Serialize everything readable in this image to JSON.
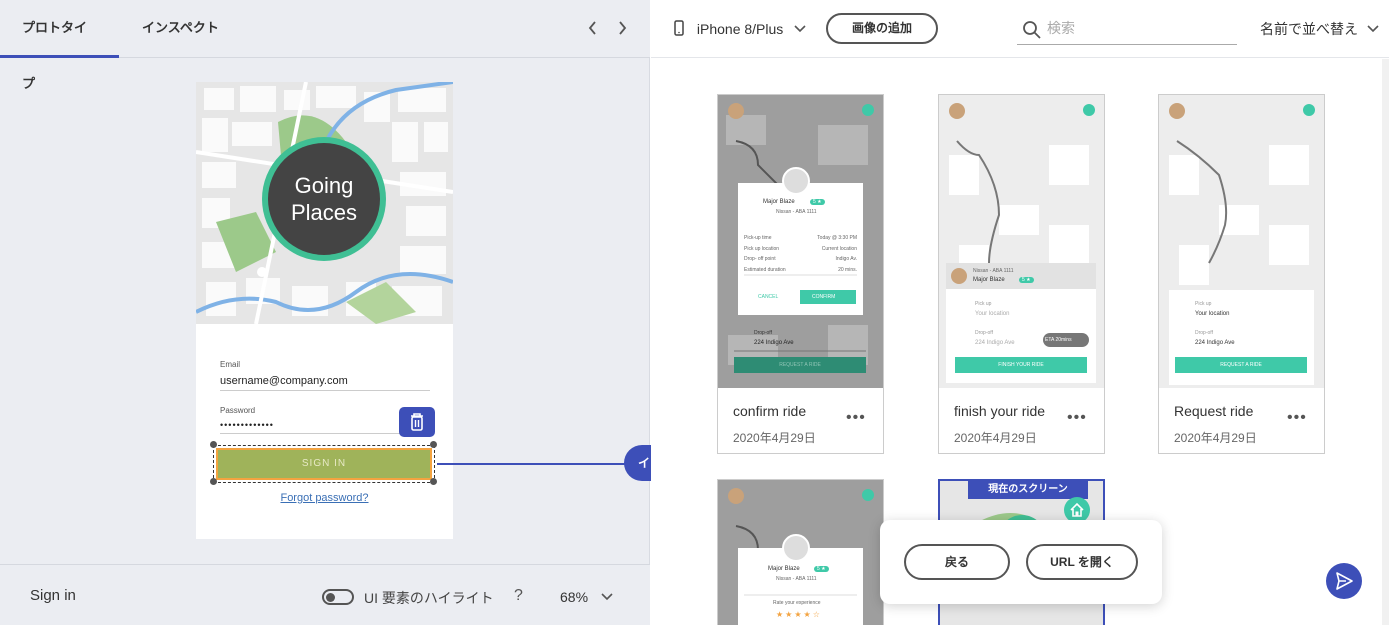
{
  "left_panel": {
    "tabs": [
      {
        "label": "プロトタイプ"
      },
      {
        "label": "インスペクト"
      }
    ],
    "prev_icon": "chevron-left-icon",
    "next_icon": "chevron-right-icon"
  },
  "phone": {
    "logo_line1": "Going",
    "logo_line2": "Places",
    "email_label": "Email",
    "email_value": "username@company.com",
    "password_label": "Password",
    "password_value": "•••••••••••••",
    "signin_label": "SIGN IN",
    "forgot_label": "Forgot password?",
    "delete_icon": "trash-icon"
  },
  "interaction": {
    "label": "インタラクションの追加"
  },
  "bottom": {
    "screen_name": "Sign in",
    "highlight_label": "UI 要素のハイライト",
    "help": "?",
    "zoom": "68%"
  },
  "topbar": {
    "device": "iPhone 8/Plus",
    "add_image": "画像の追加",
    "search_placeholder": "検索",
    "sort": "名前で並べ替え"
  },
  "screens": [
    {
      "title": "confirm ride",
      "date": "2020年4月29日",
      "more": "•••"
    },
    {
      "title": "finish your ride",
      "date": "2020年4月29日",
      "more": "•••"
    },
    {
      "title": "Request ride",
      "date": "2020年4月29日",
      "more": "•••"
    }
  ],
  "thumb_text": {
    "driver": "Major Blaze",
    "rating": "5 ★",
    "car": "Nissan - ABA 1111",
    "pickup_time_label": "Pick-up time",
    "pickup_time_value": "Today @ 3:30 PM",
    "pickup_loc_label": "Pick up location",
    "pickup_loc_value": "Current location",
    "dropoff_label": "Drop- off point",
    "dropoff_value": "Indigo Av.",
    "duration_label": "Estimated duration",
    "duration_value": "20 mins.",
    "cancel": "CANCEL",
    "confirm": "CONFIRM",
    "drop_off": "Drop-off",
    "drop_addr": "224 Indigo Ave",
    "request": "REQUEST A RIDE",
    "pick_up": "Pick up",
    "your_location": "Your location",
    "eta": "ETA 20mins",
    "finish": "FINISH YOUR RIDE",
    "rate": "Rate your experience"
  },
  "current_screen_tag": "現在のスクリーン",
  "popup": {
    "back": "戻る",
    "open_url": "URL を開く"
  },
  "colors": {
    "accent": "#3d4fb8",
    "mint": "#3fc9a8",
    "signin": "#9fb35a",
    "selection": "#f3a340"
  }
}
